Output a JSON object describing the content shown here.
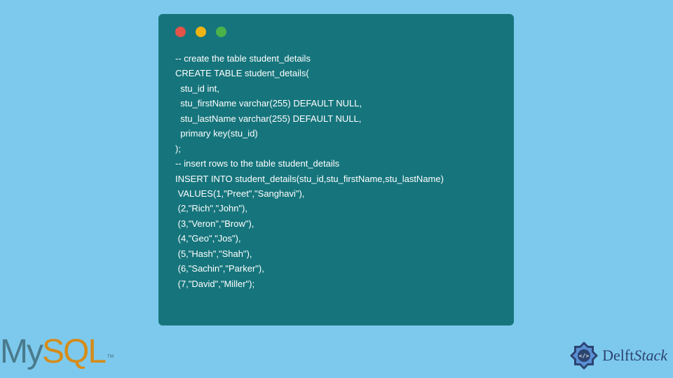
{
  "code": {
    "line1": "-- create the table student_details",
    "line2": "CREATE TABLE student_details(",
    "line3": "  stu_id int,",
    "line4": "  stu_firstName varchar(255) DEFAULT NULL,",
    "line5": "  stu_lastName varchar(255) DEFAULT NULL,",
    "line6": "  primary key(stu_id)",
    "line7": ");",
    "line8": "-- insert rows to the table student_details",
    "line9": "INSERT INTO student_details(stu_id,stu_firstName,stu_lastName)",
    "line10": " VALUES(1,\"Preet\",\"Sanghavi\"),",
    "line11": " (2,\"Rich\",\"John\"),",
    "line12": " (3,\"Veron\",\"Brow\"),",
    "line13": " (4,\"Geo\",\"Jos\"),",
    "line14": " (5,\"Hash\",\"Shah\"),",
    "line15": " (6,\"Sachin\",\"Parker\"),",
    "line16": " (7,\"David\",\"Miller\");"
  },
  "logos": {
    "mysql_my": "My",
    "mysql_sql": "SQL",
    "mysql_tm": "™",
    "delft_part1": "Delft",
    "delft_part2": "Stack"
  }
}
